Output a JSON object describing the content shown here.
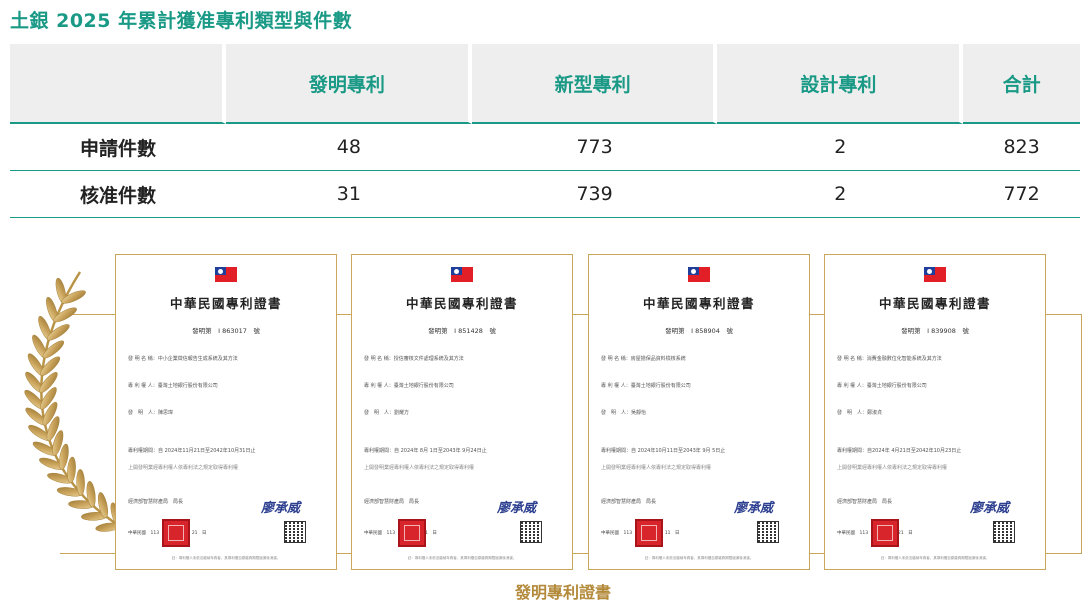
{
  "title": "土銀 2025 年累計獲准專利類型與件數",
  "table": {
    "headers": [
      "",
      "發明專利",
      "新型專利",
      "設計專利",
      "合計"
    ],
    "rows": [
      {
        "label": "申請件數",
        "values": [
          "48",
          "773",
          "2",
          "823"
        ]
      },
      {
        "label": "核准件數",
        "values": [
          "31",
          "739",
          "2",
          "772"
        ]
      }
    ]
  },
  "certificates": [
    {
      "heading": "中華民國專利證書",
      "number": "發明第　I 863017　號",
      "name": "發 明 名 稱：中小企業徵信報告生成系統及其方法",
      "holder": "專 利 權 人：臺灣土地銀行股份有限公司",
      "inventor": "發　明　人：陳思瑋",
      "term": "專利權期間：自 2024年11月21日至2042年10月31日止",
      "note": "上開發明業經專利權人依專利法之規定取得專利權",
      "office": "經濟部智慧財產局　局長",
      "signature": "廖承威",
      "date": "中華民國　113　年　11　月　21　日",
      "footer": "註：專利權人未依法繳納年費者，其專利權自原繳費期限屆滿後消滅。"
    },
    {
      "heading": "中華民國專利證書",
      "number": "發明第　I 851428　號",
      "name": "發 明 名 稱：授信審核文件處理系統及其方法",
      "holder": "專 利 權 人：臺灣土地銀行股份有限公司",
      "inventor": "發　明　人：劉耀方",
      "term": "專利權期間：自 2024年 8月 1日至2043年 9月24日止",
      "note": "上開發明業經專利權人依專利法之規定取得專利權",
      "office": "經濟部智慧財產局　局長",
      "signature": "廖承威",
      "date": "中華民國　113　年　8　月　1　日",
      "footer": "註：專利權人未依法繳納年費者，其專利權自原繳費期限屆滿後消滅。"
    },
    {
      "heading": "中華民國專利證書",
      "number": "發明第　I 858904　號",
      "name": "發 明 名 稱：房屋擔保品資料檢核系統",
      "holder": "專 利 權 人：臺灣土地銀行股份有限公司",
      "inventor": "發　明　人：吳靜怡",
      "term": "專利權期間：自 2024年10月11日至2043年 9月 5日止",
      "note": "上開發明業經專利權人依專利法之規定取得專利權",
      "office": "經濟部智慧財產局　局長",
      "signature": "廖承威",
      "date": "中華民國　113　年　10　月　11　日",
      "footer": "註：專利權人未依法繳納年費者，其專利權自原繳費期限屆滿後消滅。"
    },
    {
      "heading": "中華民國專利證書",
      "number": "發明第　I 839908　號",
      "name": "發 明 名 稱：消費金融數位化智能系統及其方法",
      "holder": "專 利 權 人：臺灣土地銀行股份有限公司",
      "inventor": "發　明　人：鄭淑貞",
      "term": "專利權期間：自2024年 4月21日至2042年10月23日止",
      "note": "上開發明業經專利權人依專利法之規定取得專利權",
      "office": "經濟部智慧財產局　局長",
      "signature": "廖承威",
      "date": "中華民國　113　年　4　月　21　日",
      "footer": "註：專利權人未依法繳納年費者，其專利權自原繳費期限屆滿後消滅。"
    }
  ],
  "caption": "發明專利證書",
  "colors": {
    "accent": "#1a9a86",
    "gold": "#b3893a",
    "header_bg": "#eeeeee"
  }
}
